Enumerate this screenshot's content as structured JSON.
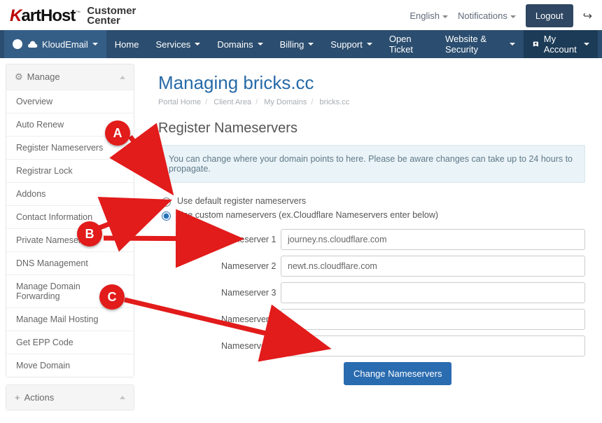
{
  "brand": {
    "logo_left": "K",
    "logo_right": "artHost",
    "tagline_line1": "Customer",
    "tagline_line2": "Center"
  },
  "top": {
    "language": "English",
    "notifications": "Notifications",
    "logout": "Logout"
  },
  "nav": {
    "primary": "KloudEmail",
    "items": [
      "Home",
      "Services",
      "Domains",
      "Billing",
      "Support",
      "Open Ticket",
      "Website & Security"
    ],
    "has_dropdown": [
      false,
      true,
      true,
      true,
      true,
      false,
      true
    ],
    "account": "My Account"
  },
  "sidebar": {
    "manage_title": "Manage",
    "manage_items": [
      "Overview",
      "Auto Renew",
      "Register Nameservers",
      "Registrar Lock",
      "Addons",
      "Contact Information",
      "Private Nameservers",
      "DNS Management",
      "Manage Domain Forwarding",
      "Manage Mail Hosting",
      "Get EPP Code",
      "Move Domain"
    ],
    "actions_title": "Actions"
  },
  "page": {
    "title": "Managing bricks.cc",
    "breadcrumb": [
      "Portal Home",
      "Client Area",
      "My Domains",
      "bricks.cc"
    ],
    "subhead": "Register Nameservers",
    "alert": "You can change where your domain points to here. Please be aware changes can take up to 24 hours to propagate.",
    "radio_default": "Use default register nameservers",
    "radio_custom": "Use custom nameservers (ex.Cloudflare Nameservers enter below)",
    "ns_labels": [
      "Nameserver 1",
      "Nameserver 2",
      "Nameserver 3",
      "Nameserver 4",
      "Nameserver 5"
    ],
    "ns_values": [
      "journey.ns.cloudflare.com",
      "newt.ns.cloudflare.com",
      "",
      "",
      ""
    ],
    "submit": "Change Nameservers"
  },
  "annotations": {
    "a": "A",
    "b": "B",
    "c": "C"
  }
}
